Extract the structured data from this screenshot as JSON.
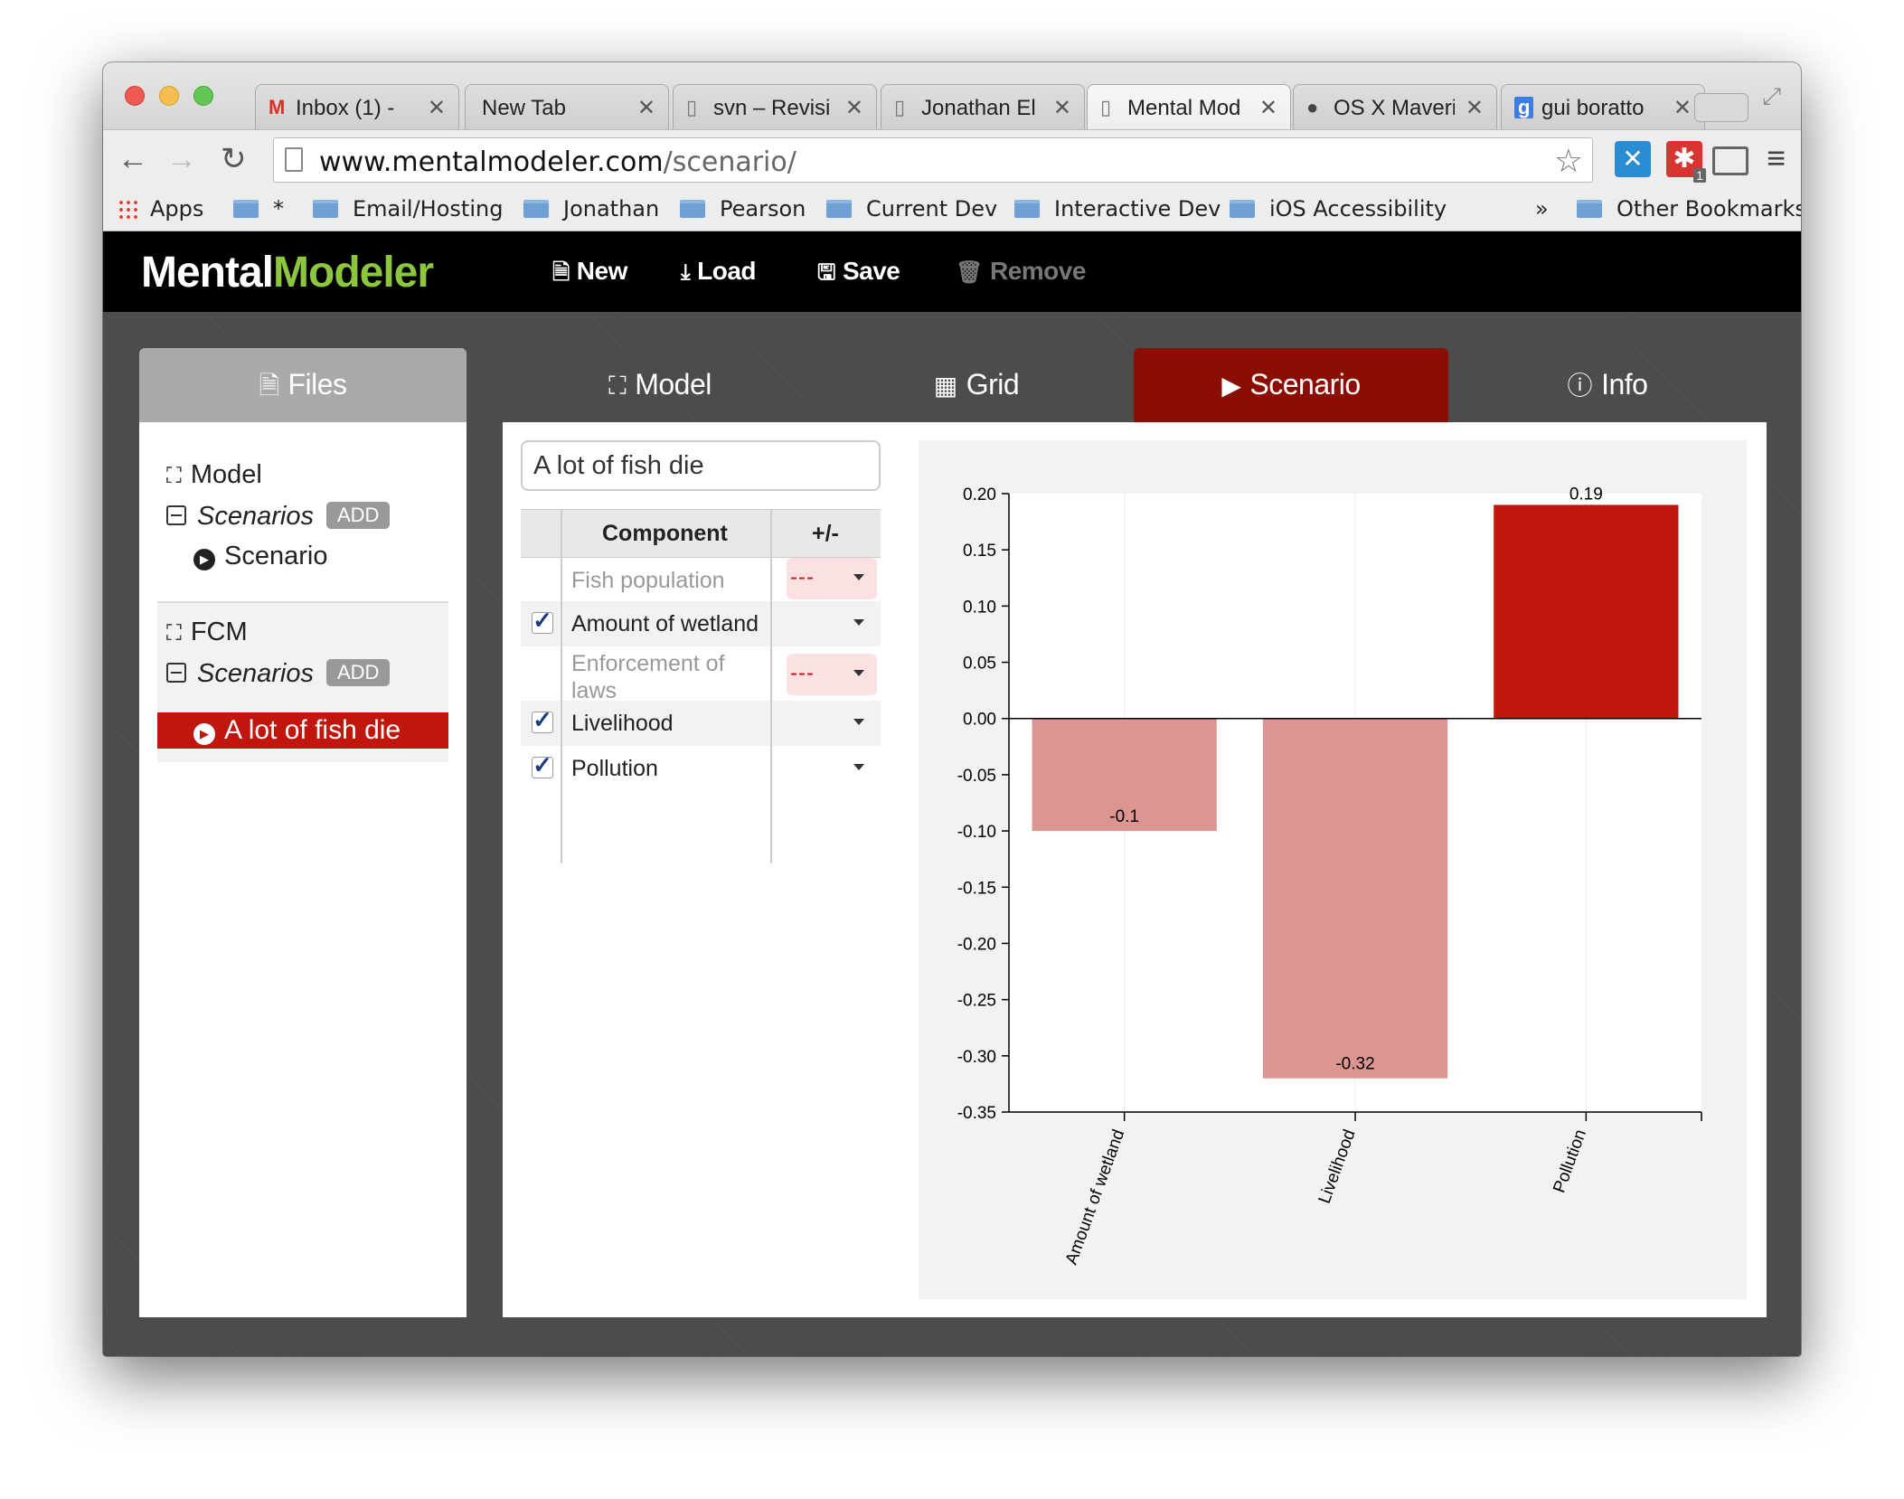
{
  "browser": {
    "tabs": [
      {
        "title": "Inbox (1) -",
        "icon": "gmail-icon",
        "active": false
      },
      {
        "title": "New Tab",
        "icon": "",
        "active": false
      },
      {
        "title": "svn – Revisi",
        "icon": "page-icon",
        "active": false
      },
      {
        "title": "Jonathan El",
        "icon": "page-icon",
        "active": false
      },
      {
        "title": "Mental Mod",
        "icon": "page-icon",
        "active": true
      },
      {
        "title": "OS X Maveri",
        "icon": "apple-icon",
        "active": false
      },
      {
        "title": "gui boratto",
        "icon": "google-icon",
        "active": false
      }
    ],
    "url_domain": "www.mentalmodeler.com",
    "url_path": "/scenario/",
    "bookmarks": [
      "Apps",
      "*",
      "Email/Hosting",
      "Jonathan",
      "Pearson",
      "Current Dev",
      "Interactive Dev",
      "iOS Accessibility"
    ],
    "bookmarks_overflow": "»",
    "other_bookmarks": "Other Bookmarks",
    "extension_badge": "1"
  },
  "app": {
    "logo_part1": "Mental",
    "logo_part2": "Modeler",
    "actions": {
      "new": "New",
      "load": "Load",
      "save": "Save",
      "remove": "Remove"
    },
    "nav_tabs": {
      "files": "Files",
      "model": "Model",
      "grid": "Grid",
      "scenario": "Scenario",
      "info": "Info"
    },
    "accent_color": "#8b0e04",
    "logo_accent_color": "#8cc63f"
  },
  "files_tree": {
    "model_label": "Model",
    "scenarios_label": "Scenarios",
    "add_label": "ADD",
    "scenario_item": "Scenario",
    "fcm_label": "FCM",
    "fcm_scenarios_label": "Scenarios",
    "fcm_add_label": "ADD",
    "selected_scenario": "A lot of fish die"
  },
  "scenario": {
    "name": "A lot of fish die",
    "table_headers": {
      "component": "Component",
      "plusminus": "+/-"
    },
    "components": [
      {
        "name": "Fish population",
        "checked": false,
        "value": "---"
      },
      {
        "name": "Amount of wetland",
        "checked": true,
        "value": ""
      },
      {
        "name": "Enforcement of laws",
        "checked": false,
        "value": "---"
      },
      {
        "name": "Livelihood",
        "checked": true,
        "value": ""
      },
      {
        "name": "Pollution",
        "checked": true,
        "value": ""
      }
    ]
  },
  "chart_data": {
    "type": "bar",
    "categories": [
      "Amount of wetland",
      "Livelihood",
      "Pollution"
    ],
    "values": [
      -0.1,
      -0.32,
      0.19
    ],
    "value_labels": [
      "-0.1",
      "-0.32",
      "0.19"
    ],
    "y_ticks": [
      "0.20",
      "0.15",
      "0.10",
      "0.05",
      "0.00",
      "-0.05",
      "-0.10",
      "-0.15",
      "-0.20",
      "-0.25",
      "-0.30",
      "-0.35"
    ],
    "ylim": [
      -0.35,
      0.2
    ],
    "grid": true,
    "colors": {
      "positive": "#c1160d",
      "negative": "#dc9590"
    }
  }
}
